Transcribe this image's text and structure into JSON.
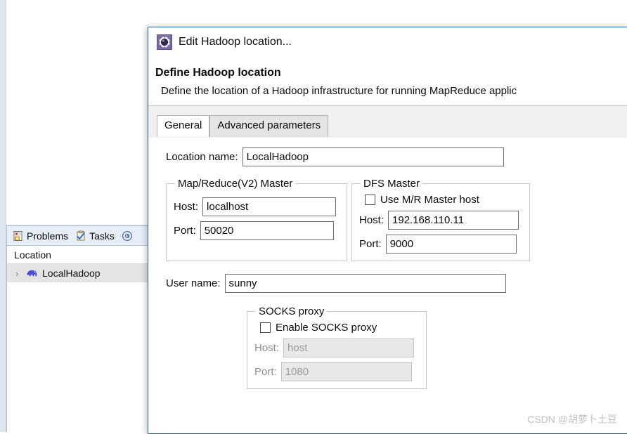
{
  "ide": {
    "bottom_view": {
      "tabs": [
        {
          "label": "Problems",
          "icon": "problems-icon",
          "active": true
        },
        {
          "label": "Tasks",
          "icon": "tasks-icon",
          "active": false
        },
        {
          "label": "",
          "icon": "javadoc-icon",
          "active": false
        }
      ],
      "column_header": "Location",
      "rows": [
        {
          "label": "LocalHadoop",
          "icon": "hadoop-elephant-icon",
          "expander": "›",
          "selected": true
        }
      ]
    }
  },
  "dialog": {
    "title": "Edit Hadoop location...",
    "title_icon": "hadoop-location-gear-icon",
    "header_title": "Define Hadoop location",
    "header_desc": "Define the location of a Hadoop infrastructure for running MapReduce applic",
    "tabs": [
      {
        "label": "General",
        "active": true
      },
      {
        "label": "Advanced parameters",
        "active": false
      }
    ],
    "location_name": {
      "label": "Location name:",
      "value": "LocalHadoop",
      "placeholder": ""
    },
    "mr_master": {
      "legend": "Map/Reduce(V2) Master",
      "host_label": "Host:",
      "host_value": "localhost",
      "port_label": "Port:",
      "port_value": "50020"
    },
    "dfs_master": {
      "legend": "DFS Master",
      "use_mr_host_label": "Use M/R Master host",
      "use_mr_host_checked": false,
      "host_label": "Host:",
      "host_value": "192.168.110.11",
      "port_label": "Port:",
      "port_value": "9000"
    },
    "user_name": {
      "label": "User name:",
      "value": "sunny"
    },
    "socks_proxy": {
      "legend": "SOCKS proxy",
      "enable_label": "Enable SOCKS proxy",
      "enabled": false,
      "host_label": "Host:",
      "host_value": "host",
      "port_label": "Port:",
      "port_value": "1080"
    }
  },
  "watermark": "CSDN @胡萝卜土豆",
  "colors": {
    "dialog_border": "#1f6eab",
    "tab_strip": "#f0f0f0",
    "selection": "#e4e4e4",
    "view_tabbar": "#e8eef7",
    "disabled_text": "#9a9a9a"
  }
}
